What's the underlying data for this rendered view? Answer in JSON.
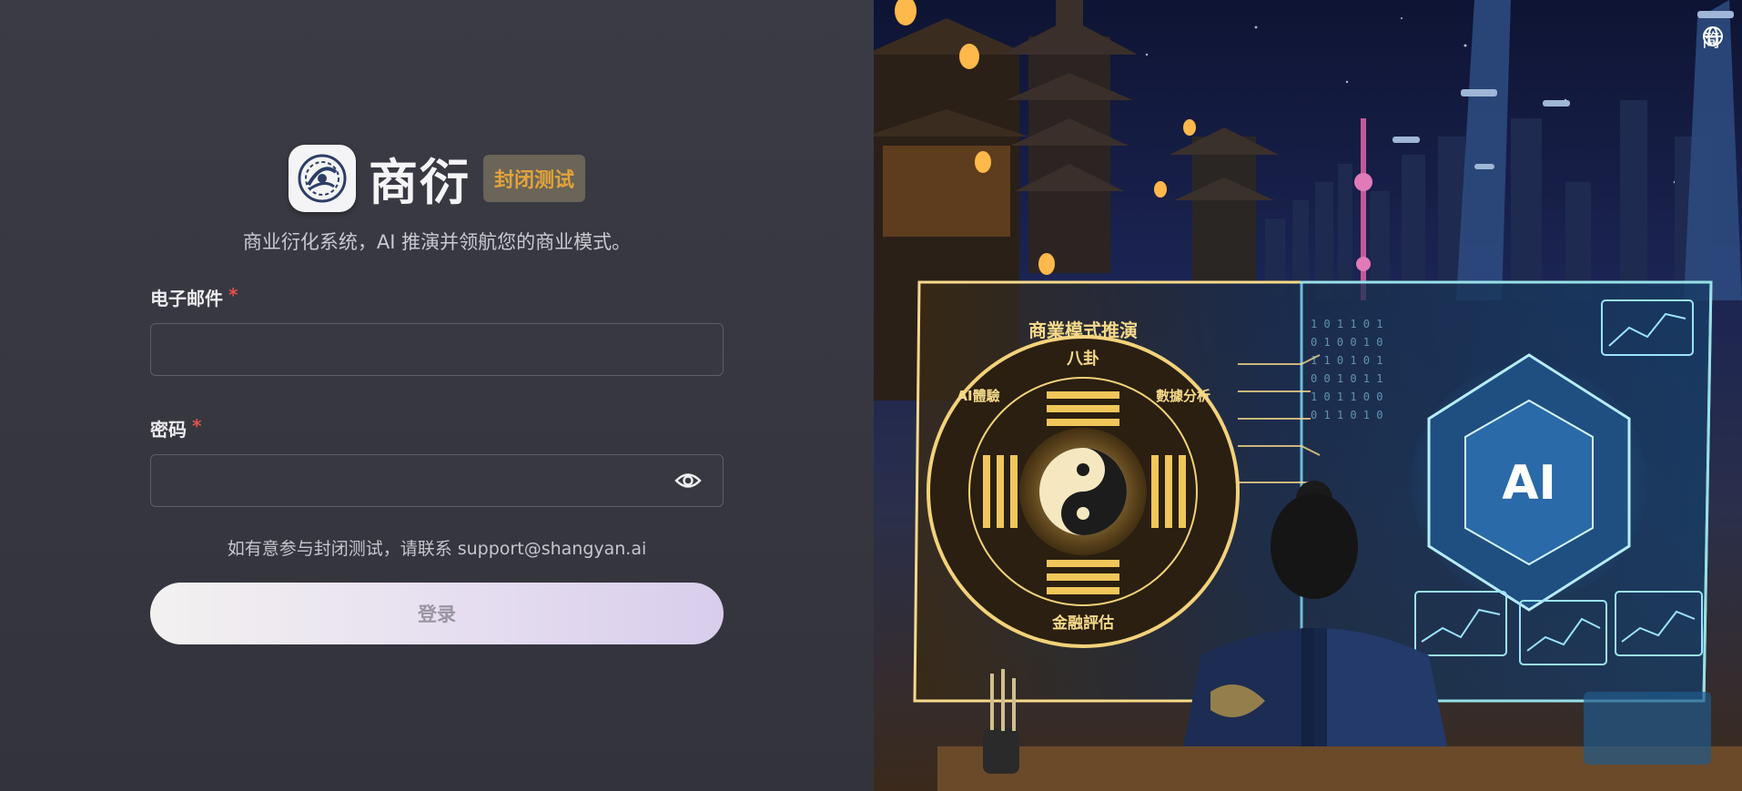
{
  "brand": {
    "app_name": "商衍",
    "badge": "封闭测试",
    "tagline": "商业衍化系统，AI 推演并领航您的商业模式。"
  },
  "form": {
    "email_label": "电子邮件",
    "email_value": "",
    "password_label": "密码",
    "password_value": "",
    "required_mark": "*"
  },
  "contact_note": "如有意参与封闭测试，请联系 support@shangyan.ai",
  "login_button": "登录",
  "language": {
    "icon": "globe-icon",
    "label": "简"
  },
  "illustration": {
    "panel_title": "商業模式推演",
    "bagua_top": "八卦",
    "bagua_bottom": "金融評估",
    "bagua_left": "AI體驗",
    "bagua_right": "數據分析",
    "core_label": "AI"
  },
  "colors": {
    "accent_orange": "#e3a33a",
    "required_red": "#e0524f",
    "panel_bg": "#3a3a44"
  }
}
